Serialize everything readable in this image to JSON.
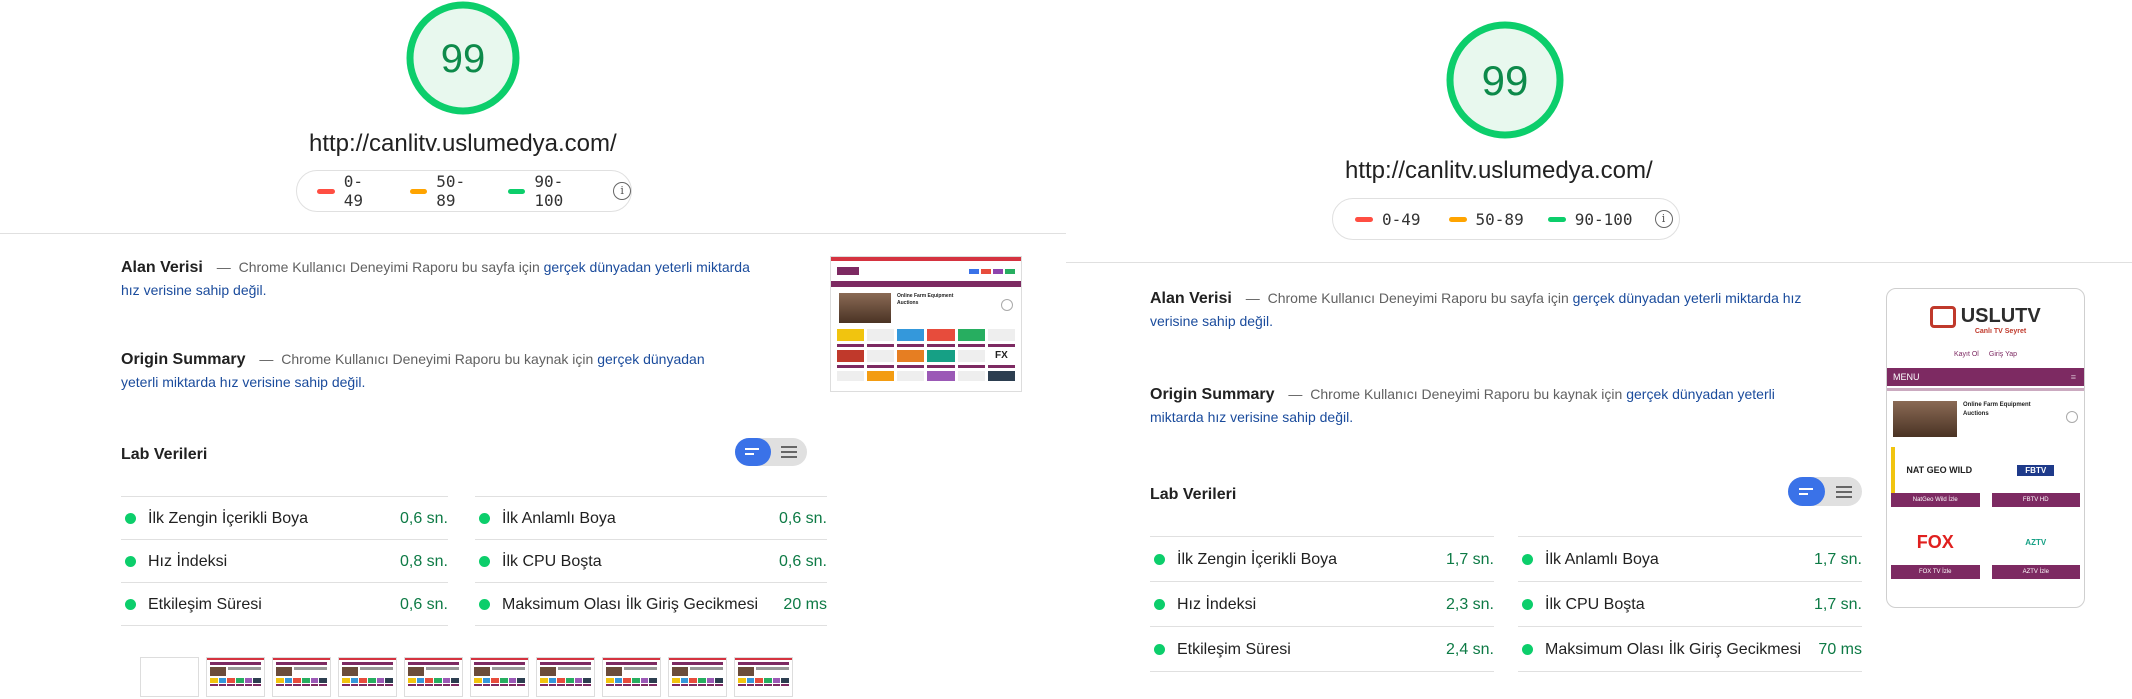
{
  "colors": {
    "pass": "#0cce6b",
    "pass_text": "#0d7a45",
    "gauge_fill": "#e8f8ee",
    "average": "#ffa400",
    "fail": "#ff4e42",
    "link": "#1a4b9c",
    "toggle_active": "#3a72e8"
  },
  "reports": [
    {
      "score": "99",
      "url": "http://canlitv.uslumedya.com/",
      "legend": [
        "0-49",
        "50-89",
        "90-100"
      ],
      "field_data": {
        "title": "Alan Verisi",
        "dash": "—",
        "text": "Chrome Kullanıcı Deneyimi Raporu bu sayfa için",
        "link": "gerçek dünyadan yeterli miktarda hız verisine sahip değil."
      },
      "origin_summary": {
        "title": "Origin Summary",
        "dash": "—",
        "text": "Chrome Kullanıcı Deneyimi Raporu bu kaynak için",
        "link": "gerçek dünyadan yeterli miktarda hız verisine sahip değil."
      },
      "lab_title": "Lab Verileri",
      "metrics": [
        {
          "label": "İlk Zengin İçerikli Boya",
          "value": "0,6 sn."
        },
        {
          "label": "İlk Anlamlı Boya",
          "value": "0,6 sn."
        },
        {
          "label": "Hız İndeksi",
          "value": "0,8 sn."
        },
        {
          "label": "İlk CPU Boşta",
          "value": "0,6 sn."
        },
        {
          "label": "Etkileşim Süresi",
          "value": "0,6 sn."
        },
        {
          "label": "Maksimum Olası İlk Giriş Gecikmesi",
          "value": "20 ms"
        }
      ]
    },
    {
      "score": "99",
      "url": "http://canlitv.uslumedya.com/",
      "legend": [
        "0-49",
        "50-89",
        "90-100"
      ],
      "field_data": {
        "title": "Alan Verisi",
        "dash": "—",
        "text": "Chrome Kullanıcı Deneyimi Raporu bu sayfa için",
        "link": "gerçek dünyadan yeterli miktarda hız verisine sahip değil."
      },
      "origin_summary": {
        "title": "Origin Summary",
        "dash": "—",
        "text": "Chrome Kullanıcı Deneyimi Raporu bu kaynak için",
        "link": "gerçek dünyadan yeterli miktarda hız verisine sahip değil."
      },
      "lab_title": "Lab Verileri",
      "metrics": [
        {
          "label": "İlk Zengin İçerikli Boya",
          "value": "1,7 sn."
        },
        {
          "label": "İlk Anlamlı Boya",
          "value": "1,7 sn."
        },
        {
          "label": "Hız İndeksi",
          "value": "2,3 sn."
        },
        {
          "label": "İlk CPU Boşta",
          "value": "1,7 sn."
        },
        {
          "label": "Etkileşim Süresi",
          "value": "2,4 sn."
        },
        {
          "label": "Maksimum Olası İlk Giriş Gecikmesi",
          "value": "70 ms"
        }
      ],
      "phone": {
        "logo": "USLUTV",
        "tagline": "Canlı TV Seyret",
        "register": "Kayıt Ol",
        "login": "Giriş Yap",
        "menu": "MENU",
        "ad_title": "Online Farm Equipment Auctions",
        "channels": [
          {
            "logo": "NAT GEO WILD",
            "label": "NatGeo Wild İzle"
          },
          {
            "logo": "FBTV",
            "label": "FBTV HD"
          },
          {
            "logo": "FOX",
            "label": "FOX TV İzle"
          },
          {
            "logo": "AZTV",
            "label": "AZTV İzle"
          }
        ]
      }
    }
  ],
  "desktop_thumb": {
    "ad_title": "Online Farm Equipment Auctions",
    "fx_logo": "FX"
  }
}
